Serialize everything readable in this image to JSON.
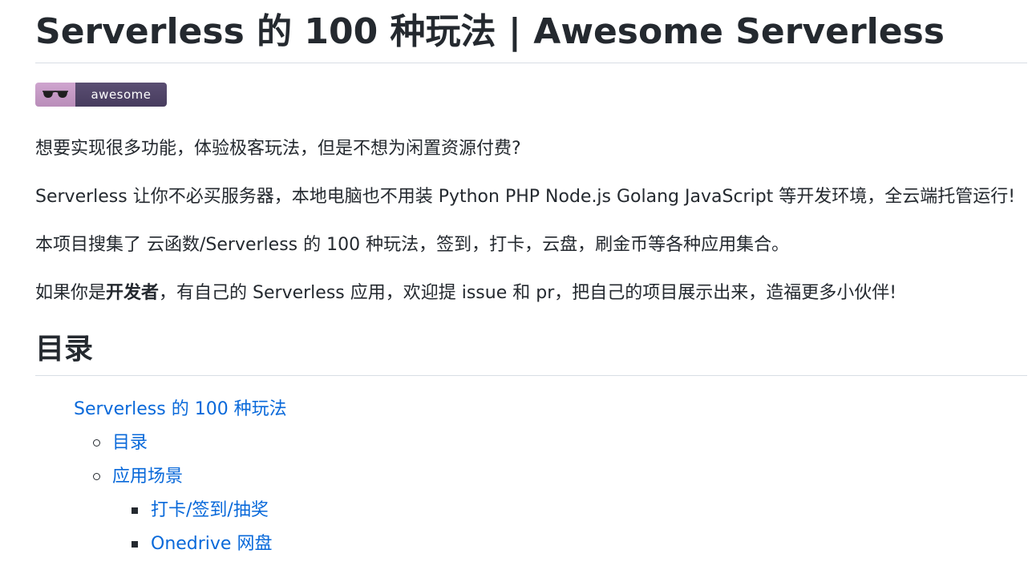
{
  "title": "Serverless 的 100 种玩法 | Awesome Serverless",
  "badge": {
    "label": "awesome",
    "icon": "sunglasses-icon",
    "colors": {
      "left": "#c89ec8",
      "right": "#4f4468"
    }
  },
  "intro": {
    "p1": "想要实现很多功能，体验极客玩法，但是不想为闲置资源付费?",
    "p2": "Serverless 让你不必买服务器，本地电脑也不用装 Python PHP Node.js Golang JavaScript 等开发环境，全云端托管运行!",
    "p3": "本项目搜集了 云函数/Serverless 的 100 种玩法，签到，打卡，云盘，刷金币等各种应用集合。",
    "p4_before": "如果你是",
    "p4_bold": "开发者",
    "p4_after": "，有自己的 Serverless 应用，欢迎提 issue 和 pr，把自己的项目展示出来，造福更多小伙伴!"
  },
  "toc": {
    "heading": "目录",
    "level1": "Serverless 的 100 种玩法",
    "level2": [
      "目录",
      "应用场景"
    ],
    "level3": [
      "打卡/签到/抽奖",
      "Onedrive 网盘"
    ]
  },
  "colors": {
    "text": "#24292f",
    "link": "#0969da",
    "divider": "#d8dee4"
  }
}
